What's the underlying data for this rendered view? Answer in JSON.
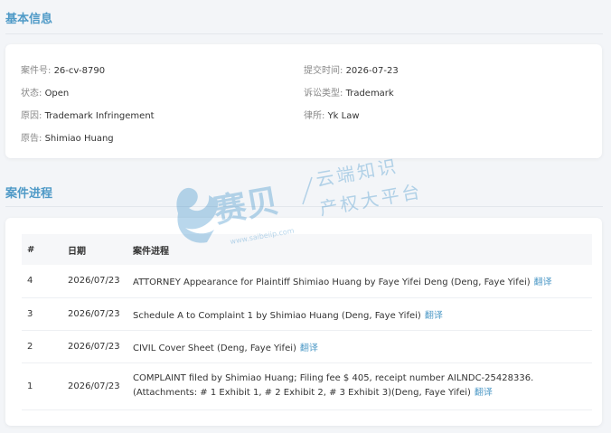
{
  "basic": {
    "title": "基本信息",
    "case_no_label": "案件号:",
    "case_no": "26-cv-8790",
    "submit_label": "提交时间:",
    "submit": "2026-07-23",
    "status_label": "状态:",
    "status": "Open",
    "type_label": "诉讼类型:",
    "type": "Trademark",
    "cause_label": "原因:",
    "cause": "Trademark Infringement",
    "firm_label": "律所:",
    "firm": "Yk Law",
    "plaintiff_label": "原告:",
    "plaintiff": "Shimiao Huang"
  },
  "progress": {
    "title": "案件进程",
    "headers": [
      "#",
      "日期",
      "案件进程"
    ],
    "translate_label": "翻译",
    "rows": [
      {
        "no": "4",
        "date": "2026/07/23",
        "text": "ATTORNEY Appearance for Plaintiff Shimiao Huang by Faye Yifei Deng (Deng, Faye Yifei)"
      },
      {
        "no": "3",
        "date": "2026/07/23",
        "text": "Schedule A to Complaint 1 by Shimiao Huang (Deng, Faye Yifei)"
      },
      {
        "no": "2",
        "date": "2026/07/23",
        "text": "CIVIL Cover Sheet (Deng, Faye Yifei)"
      },
      {
        "no": "1",
        "date": "2026/07/23",
        "text": "COMPLAINT filed by Shimiao Huang; Filing fee $ 405, receipt number AILNDC-25428336. (Attachments: # 1 Exhibit 1, # 2 Exhibit 2, # 3 Exhibit 3)(Deng, Faye Yifei)"
      }
    ]
  },
  "watermark": {
    "brand": "赛贝",
    "line1": "云端知识",
    "line2": "产权大平台",
    "url": "www.saibeiip.com"
  },
  "colors": {
    "accent": "#4f9ac7",
    "background": "#f3f5f8"
  }
}
